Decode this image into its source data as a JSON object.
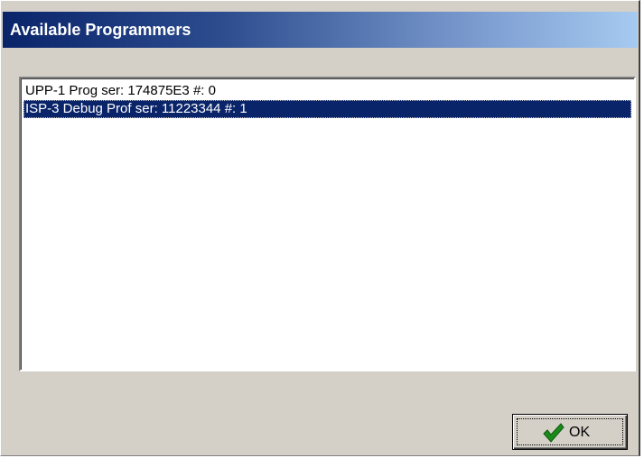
{
  "window": {
    "title": "Available Programmers"
  },
  "programmers": {
    "items": [
      {
        "label": "UPP-1 Prog ser: 174875E3 #: 0",
        "selected": false
      },
      {
        "label": "ISP-3 Debug Prof ser: 11223344 #: 1",
        "selected": true
      }
    ]
  },
  "buttons": {
    "ok_label": "OK",
    "ok_icon": "checkmark-icon"
  },
  "colors": {
    "title_gradient_start": "#0a246a",
    "title_gradient_end": "#a6caf0",
    "selection": "#0a246a",
    "dialog_face": "#d4d0c8",
    "checkmark": "#1a8a1a"
  }
}
